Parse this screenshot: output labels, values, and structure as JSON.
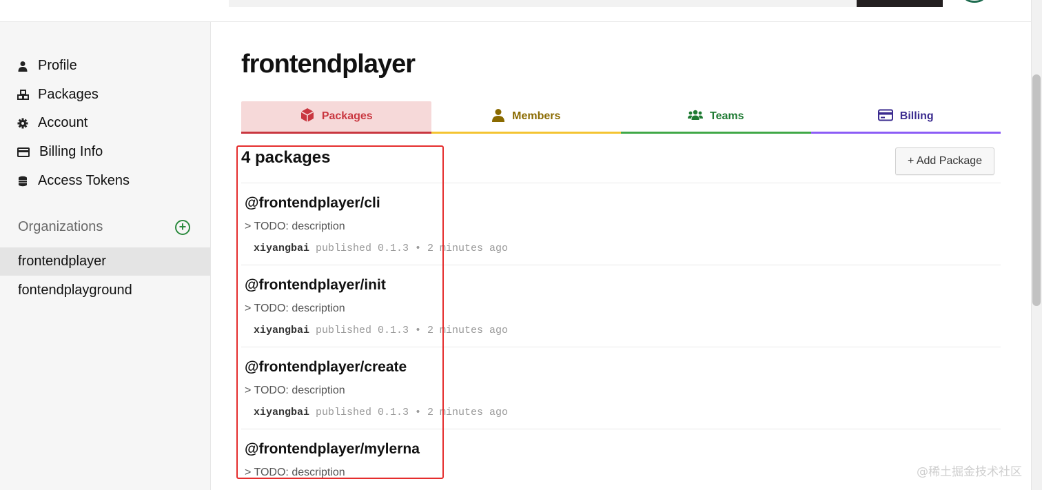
{
  "sidebar": {
    "links": [
      {
        "label": "Profile",
        "icon": "user-icon"
      },
      {
        "label": "Packages",
        "icon": "cubes-icon"
      },
      {
        "label": "Account",
        "icon": "gear-icon"
      },
      {
        "label": "Billing Info",
        "icon": "credit-card-icon"
      },
      {
        "label": "Access Tokens",
        "icon": "coins-icon"
      }
    ],
    "organizations_title": "Organizations",
    "add_org": "+",
    "organizations": [
      "frontendplayer",
      "fontendplayground"
    ]
  },
  "main": {
    "title": "frontendplayer",
    "tabs": [
      {
        "label": "Packages",
        "icon": "box-icon",
        "color": "#c9363f"
      },
      {
        "label": "Members",
        "icon": "user-icon",
        "color": "#8a6a00"
      },
      {
        "label": "Teams",
        "icon": "users-icon",
        "color": "#1e7a32"
      },
      {
        "label": "Billing",
        "icon": "credit-card-icon",
        "color": "#3b2b8f"
      }
    ],
    "package_count": "4 packages",
    "add_package": "+ Add Package",
    "packages": [
      {
        "name": "@frontendplayer/cli",
        "description": "> TODO: description",
        "user": "xiyangbai",
        "meta": " published 0.1.3 • 2 minutes ago"
      },
      {
        "name": "@frontendplayer/init",
        "description": "> TODO: description",
        "user": "xiyangbai",
        "meta": " published 0.1.3 • 2 minutes ago"
      },
      {
        "name": "@frontendplayer/create",
        "description": "> TODO: description",
        "user": "xiyangbai",
        "meta": " published 0.1.3 • 2 minutes ago"
      },
      {
        "name": "@frontendplayer/mylerna",
        "description": "> TODO: description"
      }
    ]
  },
  "watermark": "@稀土掘金技术社区",
  "colors": {
    "highlight": "#e52d2d",
    "accent_green": "#2b8a3e"
  }
}
